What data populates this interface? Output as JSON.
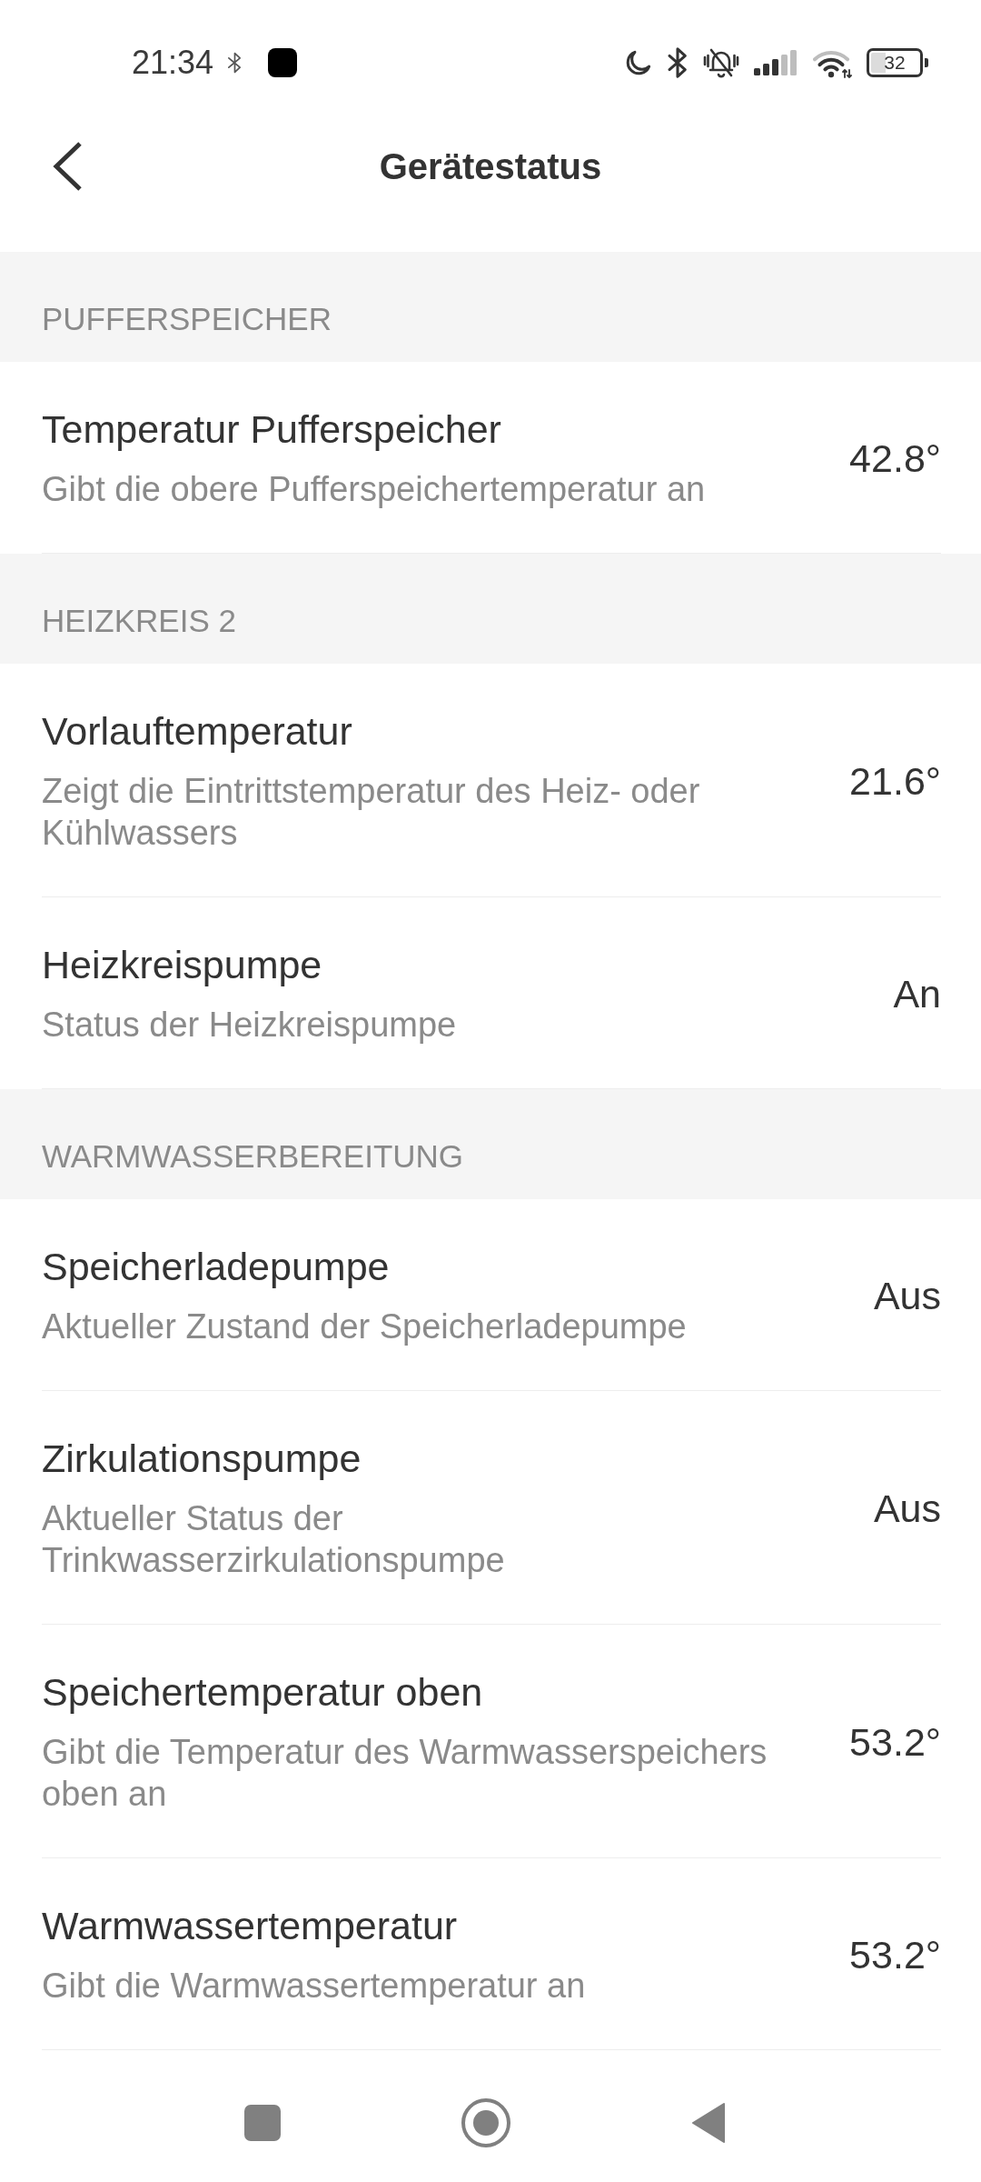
{
  "status_bar": {
    "time": "21:34",
    "battery": "32"
  },
  "header": {
    "title": "Gerätestatus"
  },
  "sections": [
    {
      "title": "PUFFERSPEICHER",
      "items": [
        {
          "title": "Temperatur Pufferspeicher",
          "description": "Gibt die obere Pufferspeichertemperatur an",
          "value": "42.8°"
        }
      ]
    },
    {
      "title": "HEIZKREIS 2",
      "items": [
        {
          "title": "Vorlauftemperatur",
          "description": "Zeigt die Eintrittstemperatur des Heiz- oder Kühlwassers",
          "value": "21.6°"
        },
        {
          "title": "Heizkreispumpe",
          "description": "Status der Heizkreispumpe",
          "value": "An"
        }
      ]
    },
    {
      "title": "WARMWASSERBEREITUNG",
      "items": [
        {
          "title": "Speicherladepumpe",
          "description": "Aktueller Zustand der Speicherladepumpe",
          "value": "Aus"
        },
        {
          "title": "Zirkulationspumpe",
          "description": "Aktueller Status der Trinkwasserzirkulationspumpe",
          "value": "Aus"
        },
        {
          "title": "Speichertemperatur oben",
          "description": "Gibt die Temperatur des Warmwasserspeichers oben an",
          "value": "53.2°"
        },
        {
          "title": "Warmwassertemperatur",
          "description": "Gibt die Warmwassertemperatur an",
          "value": "53.2°"
        }
      ]
    }
  ]
}
